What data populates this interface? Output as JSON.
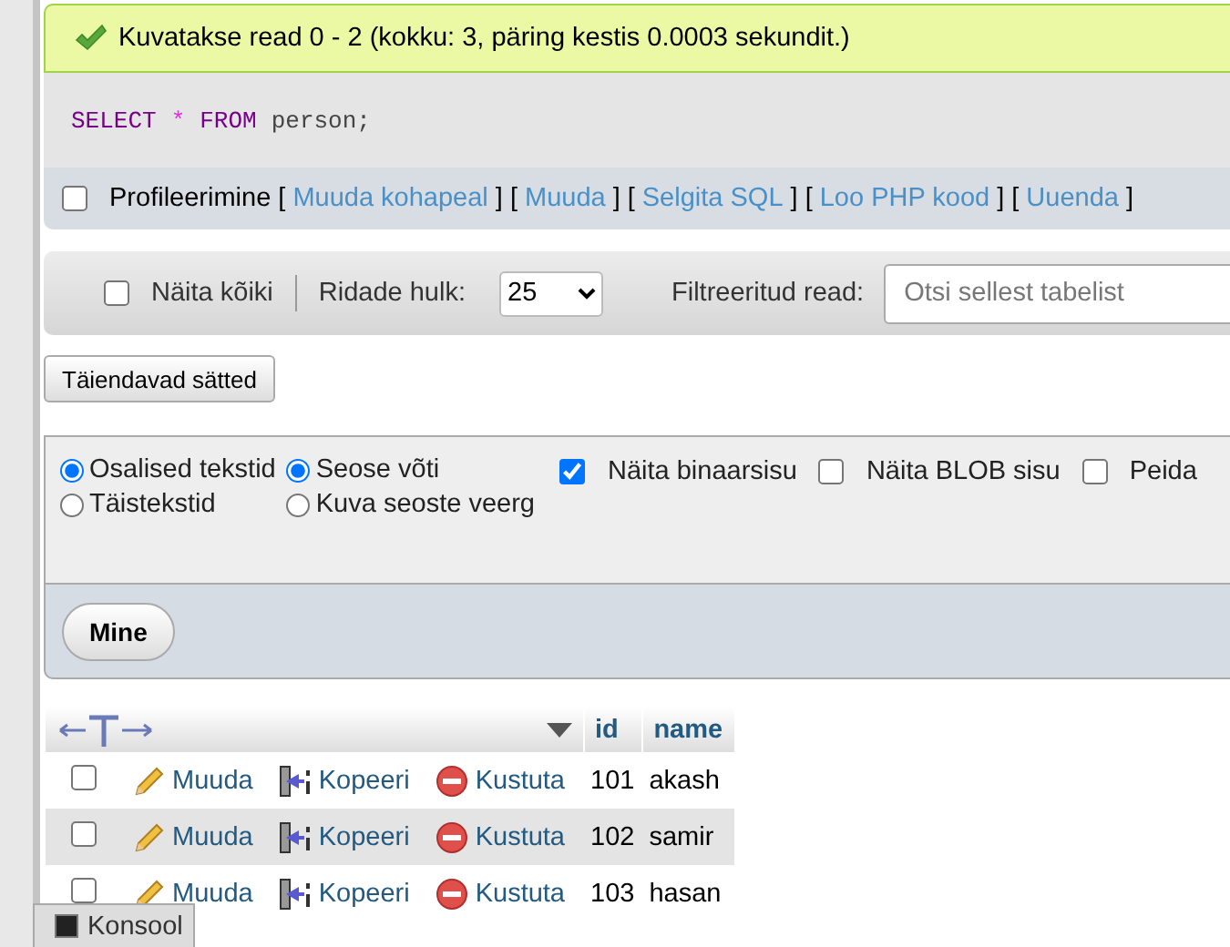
{
  "message": {
    "text": "Kuvatakse read 0 - 2 (kokku: 3, päring kestis 0.0003 sekundit.)"
  },
  "sql": {
    "tokens": [
      {
        "text": "SELECT",
        "kind": "keyword"
      },
      {
        "text": "*",
        "kind": "operator"
      },
      {
        "text": "FROM",
        "kind": "keyword"
      },
      {
        "text": "person;",
        "kind": "plain"
      }
    ]
  },
  "profiling": {
    "label": "Profileerimine",
    "checked": false,
    "bracket_open": "[",
    "bracket_close": "]",
    "links": [
      "Muuda kohapeal",
      "Muuda",
      "Selgita SQL",
      "Loo PHP kood",
      "Uuenda"
    ]
  },
  "navigation": {
    "show_all": {
      "label": "Näita kõiki",
      "checked": false
    },
    "rows_label": "Ridade hulk:",
    "rows_value": "25",
    "filter_label": "Filtreeritud read:",
    "filter_placeholder": "Otsi sellest tabelist"
  },
  "extra_options_button": "Täiendavad sätted",
  "options": {
    "radio_groups": [
      [
        {
          "label": "Osalised tekstid",
          "selected": true
        },
        {
          "label": "Täistekstid",
          "selected": false
        }
      ],
      [
        {
          "label": "Seose võti",
          "selected": true
        },
        {
          "label": "Kuva seoste veerg",
          "selected": false
        }
      ]
    ],
    "checkboxes": [
      {
        "label": "Näita binaarsisu",
        "checked": true
      },
      {
        "label": "Näita BLOB sisu",
        "checked": false
      },
      {
        "label": "Peida",
        "checked": false
      }
    ]
  },
  "go_button": "Mine",
  "table": {
    "columns": [
      "id",
      "name"
    ],
    "rows": [
      {
        "checked": false,
        "actions": [
          {
            "kind": "edit",
            "label": "Muuda"
          },
          {
            "kind": "copy",
            "label": "Kopeeri"
          },
          {
            "kind": "delete",
            "label": "Kustuta"
          }
        ],
        "id": "101",
        "name": "akash"
      },
      {
        "checked": false,
        "actions": [
          {
            "kind": "edit",
            "label": "Muuda"
          },
          {
            "kind": "copy",
            "label": "Kopeeri"
          },
          {
            "kind": "delete",
            "label": "Kustuta"
          }
        ],
        "id": "102",
        "name": "samir"
      },
      {
        "checked": false,
        "actions": [
          {
            "kind": "edit",
            "label": "Muuda"
          },
          {
            "kind": "copy",
            "label": "Kopeeri"
          },
          {
            "kind": "delete",
            "label": "Kustuta"
          }
        ],
        "id": "103",
        "name": "hasan"
      }
    ]
  },
  "console": {
    "label": "Konsool"
  }
}
